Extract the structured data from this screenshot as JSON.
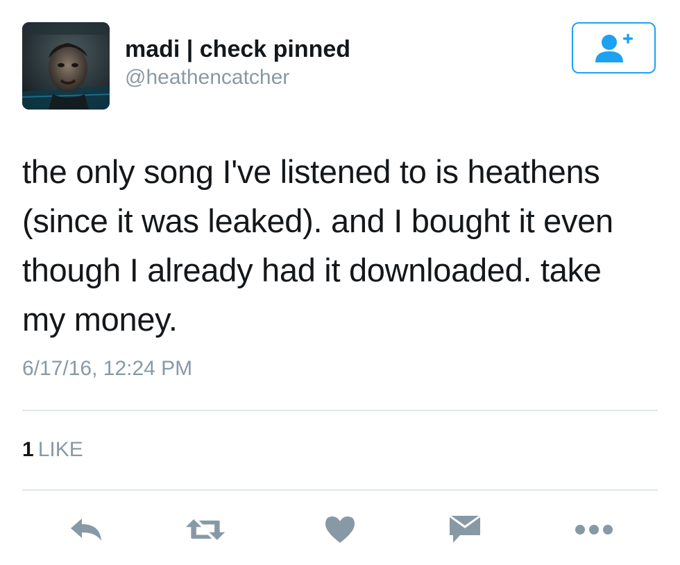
{
  "user": {
    "display_name": "madi | check pinned",
    "handle": "@heathencatcher",
    "avatar_icon": "profile-photo"
  },
  "follow_button": {
    "icon": "add-user-icon",
    "accent_color": "#1da1f2"
  },
  "tweet": {
    "text_lines": [
      "the only song I've listened to is heathens",
      "(since it was leaked). and I bought it even",
      "though I already had it downloaded. take",
      "my money."
    ],
    "timestamp": "6/17/16, 12:24 PM"
  },
  "stats": {
    "like_count": "1",
    "like_label": "LIKE"
  },
  "actions": [
    {
      "name": "reply",
      "icon": "reply-icon"
    },
    {
      "name": "retweet",
      "icon": "retweet-icon"
    },
    {
      "name": "like",
      "icon": "heart-icon"
    },
    {
      "name": "direct-message",
      "icon": "envelope-icon"
    },
    {
      "name": "more",
      "icon": "more-icon"
    }
  ],
  "colors": {
    "text": "#14171a",
    "secondary": "#8899a6",
    "action_icon": "#8899a6",
    "divider": "#e1e8ed"
  }
}
